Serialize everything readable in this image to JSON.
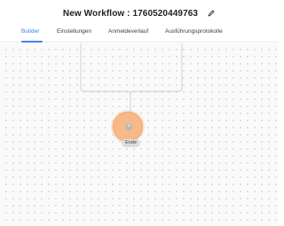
{
  "header": {
    "title": "New Workflow : 1760520449763",
    "edit_icon": "pencil-icon"
  },
  "tabs": [
    {
      "label": "Builder",
      "active": true
    },
    {
      "label": "Einstellungen",
      "active": false
    },
    {
      "label": "Anmeldeverlauf",
      "active": false
    },
    {
      "label": "Ausführungsprotokolle",
      "active": false
    }
  ],
  "canvas": {
    "end_node": {
      "label": "Ende",
      "add_icon": "plus-icon"
    }
  },
  "colors": {
    "accent": "#3b82f6",
    "end_node_fill": "#f7b98a"
  }
}
